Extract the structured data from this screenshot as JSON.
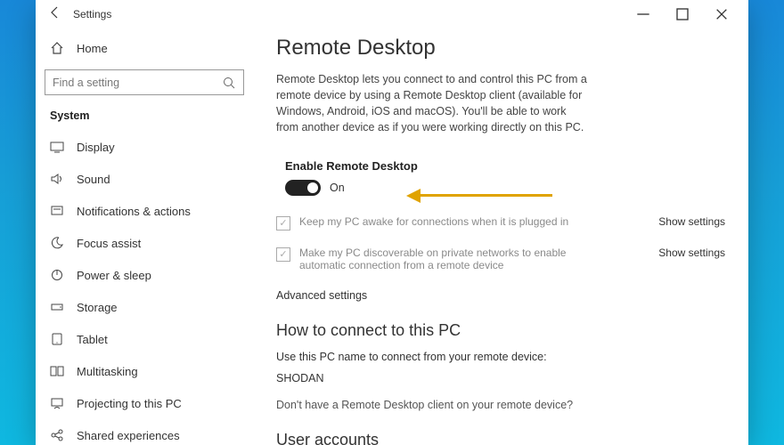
{
  "titlebar": {
    "title": "Settings"
  },
  "sidebar": {
    "home": "Home",
    "search_placeholder": "Find a setting",
    "group": "System",
    "items": [
      {
        "label": "Display"
      },
      {
        "label": "Sound"
      },
      {
        "label": "Notifications & actions"
      },
      {
        "label": "Focus assist"
      },
      {
        "label": "Power & sleep"
      },
      {
        "label": "Storage"
      },
      {
        "label": "Tablet"
      },
      {
        "label": "Multitasking"
      },
      {
        "label": "Projecting to this PC"
      },
      {
        "label": "Shared experiences"
      }
    ]
  },
  "main": {
    "heading": "Remote Desktop",
    "description": "Remote Desktop lets you connect to and control this PC from a remote device by using a Remote Desktop client (available for Windows, Android, iOS and macOS). You'll be able to work from another device as if you were working directly on this PC.",
    "toggle": {
      "label": "Enable Remote Desktop",
      "state": "On"
    },
    "option1": {
      "text": "Keep my PC awake for connections when it is plugged in",
      "link": "Show settings"
    },
    "option2": {
      "text": "Make my PC discoverable on private networks to enable automatic connection from a remote device",
      "link": "Show settings"
    },
    "advanced": "Advanced settings",
    "connect_heading": "How to connect to this PC",
    "connect_sub": "Use this PC name to connect from your remote device:",
    "pc_name": "SHODAN",
    "no_client": "Don't have a Remote Desktop client on your remote device?",
    "user_accounts": "User accounts"
  }
}
